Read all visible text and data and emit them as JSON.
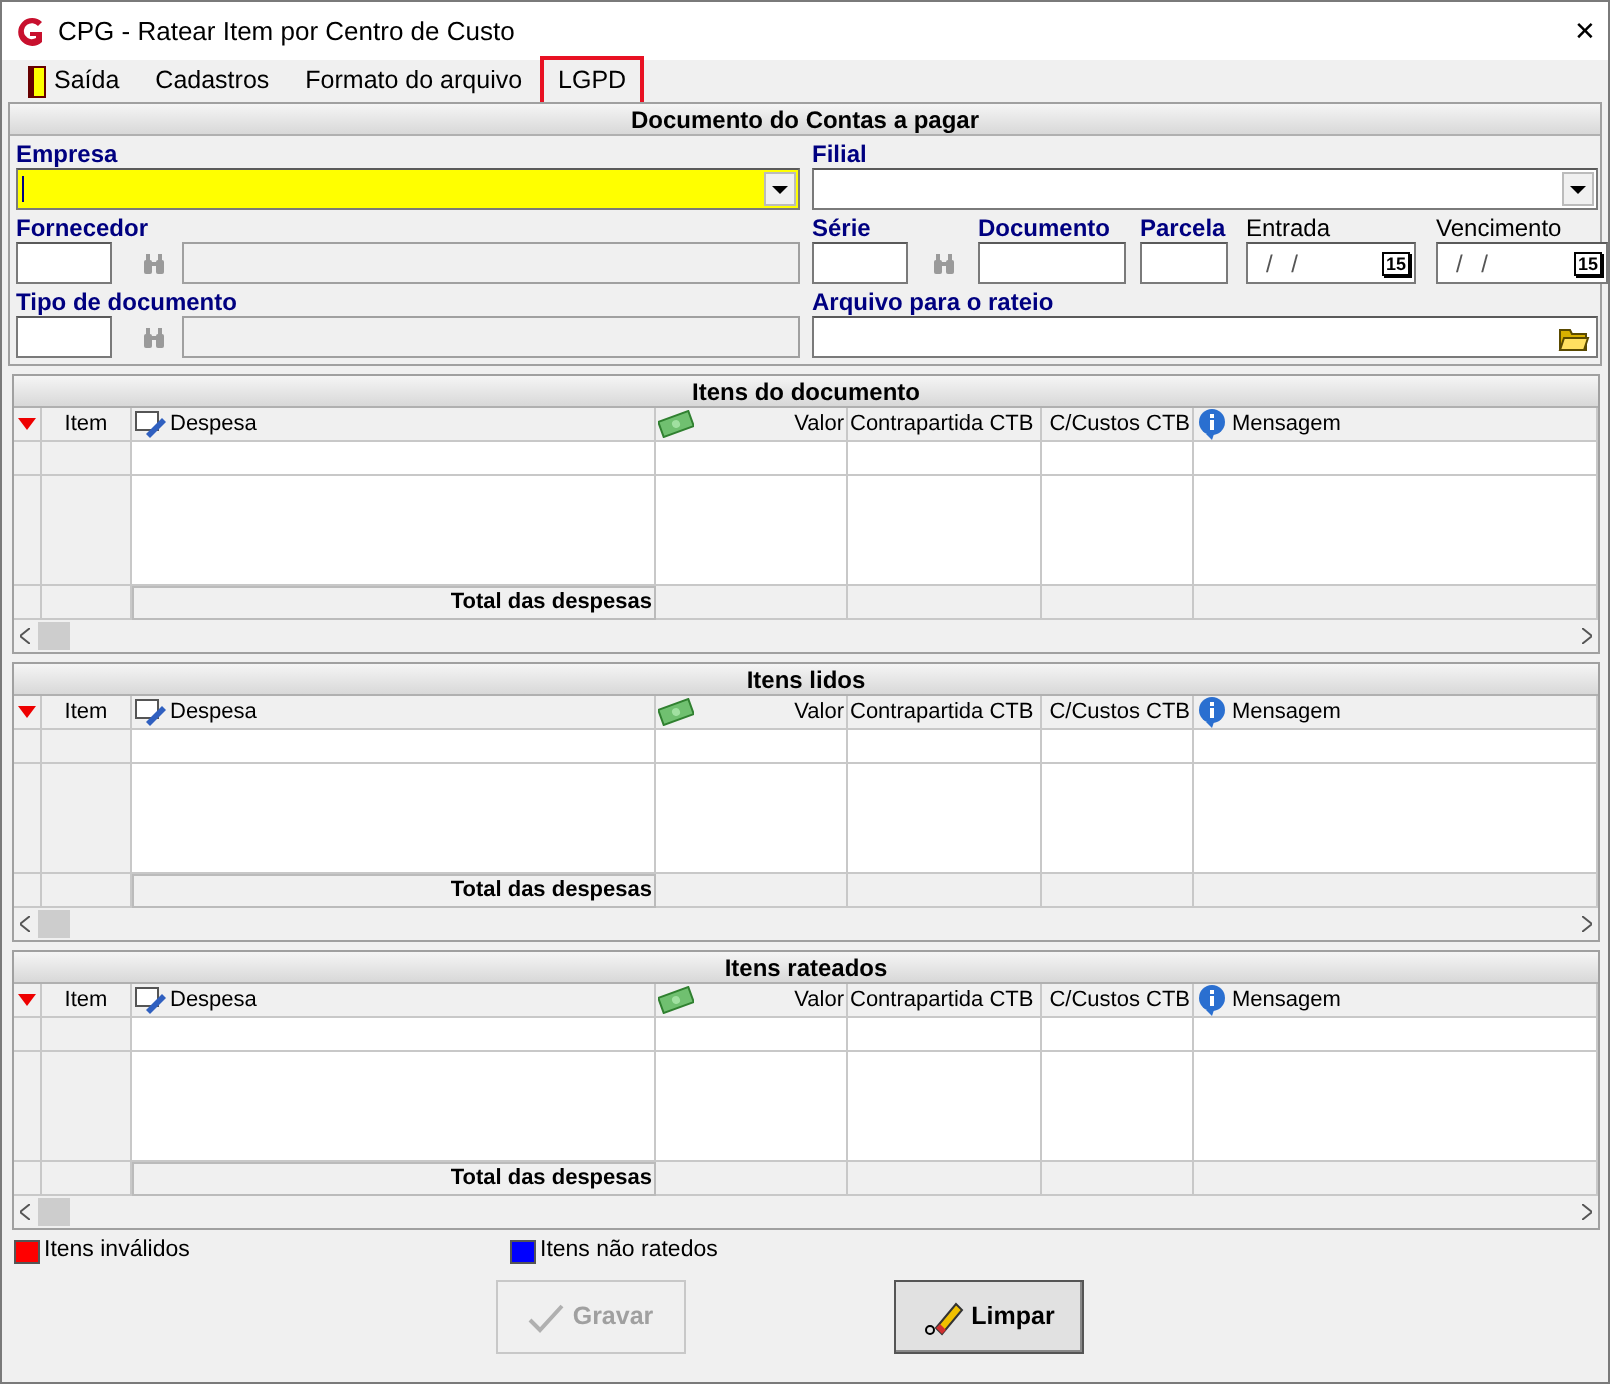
{
  "window": {
    "title": "CPG - Ratear Item por Centro de Custo",
    "close": "✕"
  },
  "menu": [
    {
      "label": "Saída",
      "highlighted": false
    },
    {
      "label": "Cadastros",
      "highlighted": false
    },
    {
      "label": "Formato do arquivo",
      "highlighted": false
    },
    {
      "label": "LGPD",
      "highlighted": true
    }
  ],
  "panel_title": "Documento do Contas a pagar",
  "form": {
    "left": [
      {
        "label": "Empresa",
        "kind": "combo",
        "bold": true,
        "focused": true
      },
      {
        "label": "Fornecedor",
        "kind": "lookup",
        "bold": true,
        "focused": false
      },
      {
        "label": "Tipo de documento",
        "kind": "lookup",
        "bold": true,
        "focused": false
      }
    ],
    "right": [
      {
        "label": "Filial",
        "kind": "combo",
        "bold": true,
        "focused": false
      },
      {
        "kind": "row",
        "fields": [
          {
            "label": "Série",
            "kind": "code",
            "bold": true
          },
          {
            "label": "Documento",
            "kind": "text",
            "bold": true
          },
          {
            "label": "Parcela",
            "kind": "text",
            "bold": true
          },
          {
            "label": "Entrada",
            "kind": "date",
            "bold": false,
            "value": "/ /",
            "calendar_day": "15"
          },
          {
            "label": "Vencimento",
            "kind": "date",
            "bold": false,
            "value": "/ /",
            "calendar_day": "15"
          }
        ]
      },
      {
        "label": "Arquivo para o rateio",
        "kind": "file",
        "bold": true,
        "focused": false
      }
    ]
  },
  "grids": [
    {
      "title": "Itens do documento",
      "columns": [
        "Item",
        "Despesa",
        "Valor",
        "Contrapartida CTB",
        "C/Custos CTB",
        "Mensagem"
      ],
      "total_label": "Total das despesas"
    },
    {
      "title": "Itens lidos",
      "columns": [
        "Item",
        "Despesa",
        "Valor",
        "Contrapartida CTB",
        "C/Custos CTB",
        "Mensagem"
      ],
      "total_label": "Total das despesas"
    },
    {
      "title": "Itens rateados",
      "columns": [
        "Item",
        "Despesa",
        "Valor",
        "Contrapartida CTB",
        "C/Custos CTB",
        "Mensagem"
      ],
      "total_label": "Total das despesas"
    }
  ],
  "legend": [
    {
      "label": "Itens inválidos",
      "color": "#ff0000"
    },
    {
      "label": "Itens não ratedos",
      "color": "#0000ff"
    }
  ],
  "buttons": [
    {
      "label": "Gravar",
      "disabled": true
    },
    {
      "label": "Limpar",
      "disabled": false
    }
  ]
}
